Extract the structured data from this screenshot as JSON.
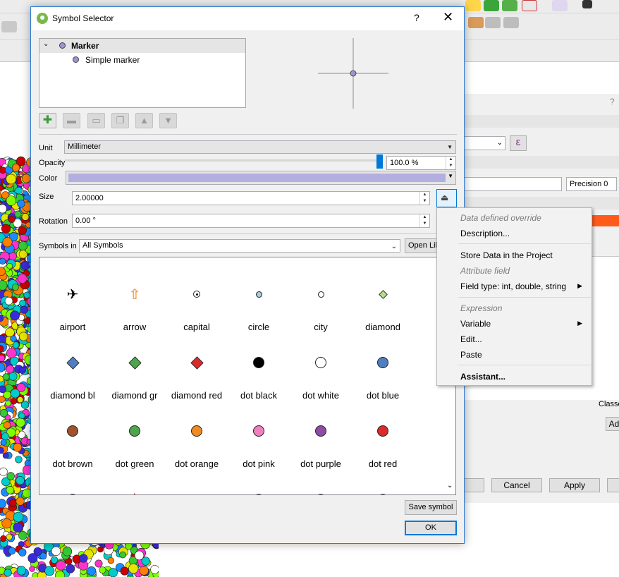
{
  "dialog": {
    "title": "Symbol Selector",
    "help_label": "?",
    "close_label": "✕"
  },
  "layer_tree": {
    "root_label": "Marker",
    "child_label": "Simple marker"
  },
  "layer_buttons": [
    "add-layer-icon",
    "remove-layer-icon",
    "lock-layer-icon",
    "duplicate-layer-icon",
    "move-up-icon",
    "move-down-icon"
  ],
  "properties": {
    "unit_label": "Unit",
    "unit_value": "Millimeter",
    "opacity_label": "Opacity",
    "opacity_value": "100.0 %",
    "opacity_fraction": 1.0,
    "color_label": "Color",
    "color_value": "#b3aee0",
    "size_label": "Size",
    "size_value": "2.00000",
    "rotation_label": "Rotation",
    "rotation_value": "0.00 °"
  },
  "symbols_in": {
    "label": "Symbols in",
    "value": "All Symbols",
    "open_library_label": "Open Lib"
  },
  "symbols": [
    {
      "name": "airport",
      "shape": "airport",
      "color": "#000000"
    },
    {
      "name": "arrow",
      "shape": "arrow",
      "color": "#f0a050"
    },
    {
      "name": "capital",
      "shape": "capital",
      "color": "#ffffff"
    },
    {
      "name": "circle",
      "shape": "smallcircle",
      "color": "#a6cee3"
    },
    {
      "name": "city",
      "shape": "smallcircle",
      "color": "#ffffff"
    },
    {
      "name": "diamond",
      "shape": "smalldiamond",
      "color": "#b2df8a"
    },
    {
      "name": "diamond bl",
      "shape": "diamond",
      "color": "#4f7fbf"
    },
    {
      "name": "diamond gr",
      "shape": "diamond",
      "color": "#4ca64c"
    },
    {
      "name": "diamond red",
      "shape": "diamond",
      "color": "#d92b2b"
    },
    {
      "name": "dot  black",
      "shape": "dot",
      "color": "#000000"
    },
    {
      "name": "dot  white",
      "shape": "dot",
      "color": "#ffffff"
    },
    {
      "name": "dot blue",
      "shape": "dot",
      "color": "#4f7fbf"
    },
    {
      "name": "dot brown",
      "shape": "dot",
      "color": "#a0522d"
    },
    {
      "name": "dot green",
      "shape": "dot",
      "color": "#4ca64c"
    },
    {
      "name": "dot orange",
      "shape": "dot",
      "color": "#f08a24"
    },
    {
      "name": "dot pink",
      "shape": "dot",
      "color": "#f07fbf"
    },
    {
      "name": "dot purple",
      "shape": "dot",
      "color": "#8e4ca6"
    },
    {
      "name": "dot red",
      "shape": "dot",
      "color": "#d92b2b"
    },
    {
      "name": "",
      "shape": "dot",
      "color": "#ffff33"
    },
    {
      "name": "",
      "shape": "star",
      "color": "#e31a1c"
    },
    {
      "name": "",
      "shape": "pin",
      "color": "#ffffff"
    },
    {
      "name": "",
      "shape": "dot",
      "color": "#ffffff"
    },
    {
      "name": "",
      "shape": "dot",
      "color": "#bfbfbf"
    },
    {
      "name": "",
      "shape": "dot",
      "color": "#999999"
    }
  ],
  "footer": {
    "save_symbol_label": "Save symbol",
    "ok_label": "OK"
  },
  "context_menu": {
    "header": "Data defined override",
    "description": "Description...",
    "store_data": "Store Data in the Project",
    "attribute_field": "Attribute field",
    "field_type": "Field type: int, double, string",
    "expression": "Expression",
    "variable": "Variable",
    "edit": "Edit...",
    "paste": "Paste",
    "assistant": "Assistant..."
  },
  "background_window": {
    "help_label": "?",
    "epsilon_label": "ε",
    "precision_label": "Precision 0",
    "classes_label": "Classe",
    "adv_label": "Adv",
    "cancel_label": "Cancel",
    "apply_label": "Apply"
  }
}
